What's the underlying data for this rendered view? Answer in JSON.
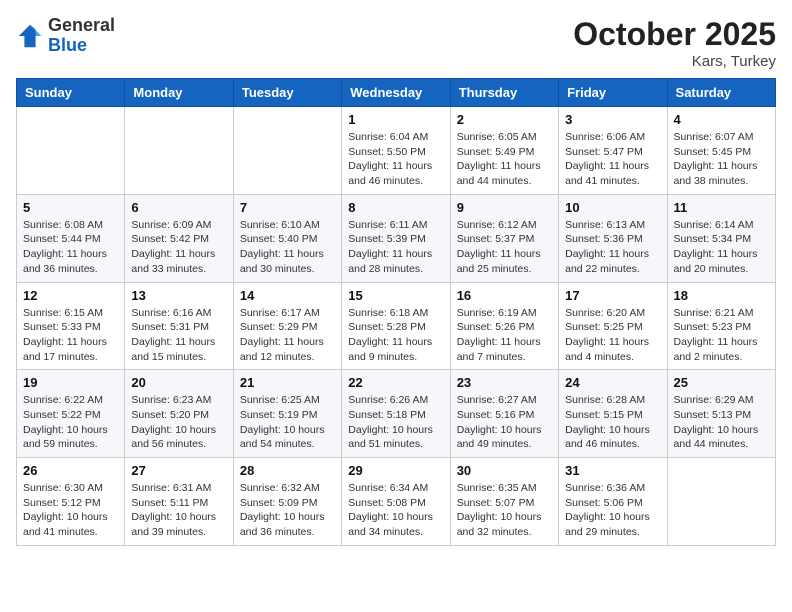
{
  "header": {
    "logo_general": "General",
    "logo_blue": "Blue",
    "month_title": "October 2025",
    "location": "Kars, Turkey"
  },
  "weekdays": [
    "Sunday",
    "Monday",
    "Tuesday",
    "Wednesday",
    "Thursday",
    "Friday",
    "Saturday"
  ],
  "weeks": [
    [
      {
        "day": "",
        "info": ""
      },
      {
        "day": "",
        "info": ""
      },
      {
        "day": "",
        "info": ""
      },
      {
        "day": "1",
        "info": "Sunrise: 6:04 AM\nSunset: 5:50 PM\nDaylight: 11 hours and 46 minutes."
      },
      {
        "day": "2",
        "info": "Sunrise: 6:05 AM\nSunset: 5:49 PM\nDaylight: 11 hours and 44 minutes."
      },
      {
        "day": "3",
        "info": "Sunrise: 6:06 AM\nSunset: 5:47 PM\nDaylight: 11 hours and 41 minutes."
      },
      {
        "day": "4",
        "info": "Sunrise: 6:07 AM\nSunset: 5:45 PM\nDaylight: 11 hours and 38 minutes."
      }
    ],
    [
      {
        "day": "5",
        "info": "Sunrise: 6:08 AM\nSunset: 5:44 PM\nDaylight: 11 hours and 36 minutes."
      },
      {
        "day": "6",
        "info": "Sunrise: 6:09 AM\nSunset: 5:42 PM\nDaylight: 11 hours and 33 minutes."
      },
      {
        "day": "7",
        "info": "Sunrise: 6:10 AM\nSunset: 5:40 PM\nDaylight: 11 hours and 30 minutes."
      },
      {
        "day": "8",
        "info": "Sunrise: 6:11 AM\nSunset: 5:39 PM\nDaylight: 11 hours and 28 minutes."
      },
      {
        "day": "9",
        "info": "Sunrise: 6:12 AM\nSunset: 5:37 PM\nDaylight: 11 hours and 25 minutes."
      },
      {
        "day": "10",
        "info": "Sunrise: 6:13 AM\nSunset: 5:36 PM\nDaylight: 11 hours and 22 minutes."
      },
      {
        "day": "11",
        "info": "Sunrise: 6:14 AM\nSunset: 5:34 PM\nDaylight: 11 hours and 20 minutes."
      }
    ],
    [
      {
        "day": "12",
        "info": "Sunrise: 6:15 AM\nSunset: 5:33 PM\nDaylight: 11 hours and 17 minutes."
      },
      {
        "day": "13",
        "info": "Sunrise: 6:16 AM\nSunset: 5:31 PM\nDaylight: 11 hours and 15 minutes."
      },
      {
        "day": "14",
        "info": "Sunrise: 6:17 AM\nSunset: 5:29 PM\nDaylight: 11 hours and 12 minutes."
      },
      {
        "day": "15",
        "info": "Sunrise: 6:18 AM\nSunset: 5:28 PM\nDaylight: 11 hours and 9 minutes."
      },
      {
        "day": "16",
        "info": "Sunrise: 6:19 AM\nSunset: 5:26 PM\nDaylight: 11 hours and 7 minutes."
      },
      {
        "day": "17",
        "info": "Sunrise: 6:20 AM\nSunset: 5:25 PM\nDaylight: 11 hours and 4 minutes."
      },
      {
        "day": "18",
        "info": "Sunrise: 6:21 AM\nSunset: 5:23 PM\nDaylight: 11 hours and 2 minutes."
      }
    ],
    [
      {
        "day": "19",
        "info": "Sunrise: 6:22 AM\nSunset: 5:22 PM\nDaylight: 10 hours and 59 minutes."
      },
      {
        "day": "20",
        "info": "Sunrise: 6:23 AM\nSunset: 5:20 PM\nDaylight: 10 hours and 56 minutes."
      },
      {
        "day": "21",
        "info": "Sunrise: 6:25 AM\nSunset: 5:19 PM\nDaylight: 10 hours and 54 minutes."
      },
      {
        "day": "22",
        "info": "Sunrise: 6:26 AM\nSunset: 5:18 PM\nDaylight: 10 hours and 51 minutes."
      },
      {
        "day": "23",
        "info": "Sunrise: 6:27 AM\nSunset: 5:16 PM\nDaylight: 10 hours and 49 minutes."
      },
      {
        "day": "24",
        "info": "Sunrise: 6:28 AM\nSunset: 5:15 PM\nDaylight: 10 hours and 46 minutes."
      },
      {
        "day": "25",
        "info": "Sunrise: 6:29 AM\nSunset: 5:13 PM\nDaylight: 10 hours and 44 minutes."
      }
    ],
    [
      {
        "day": "26",
        "info": "Sunrise: 6:30 AM\nSunset: 5:12 PM\nDaylight: 10 hours and 41 minutes."
      },
      {
        "day": "27",
        "info": "Sunrise: 6:31 AM\nSunset: 5:11 PM\nDaylight: 10 hours and 39 minutes."
      },
      {
        "day": "28",
        "info": "Sunrise: 6:32 AM\nSunset: 5:09 PM\nDaylight: 10 hours and 36 minutes."
      },
      {
        "day": "29",
        "info": "Sunrise: 6:34 AM\nSunset: 5:08 PM\nDaylight: 10 hours and 34 minutes."
      },
      {
        "day": "30",
        "info": "Sunrise: 6:35 AM\nSunset: 5:07 PM\nDaylight: 10 hours and 32 minutes."
      },
      {
        "day": "31",
        "info": "Sunrise: 6:36 AM\nSunset: 5:06 PM\nDaylight: 10 hours and 29 minutes."
      },
      {
        "day": "",
        "info": ""
      }
    ]
  ]
}
